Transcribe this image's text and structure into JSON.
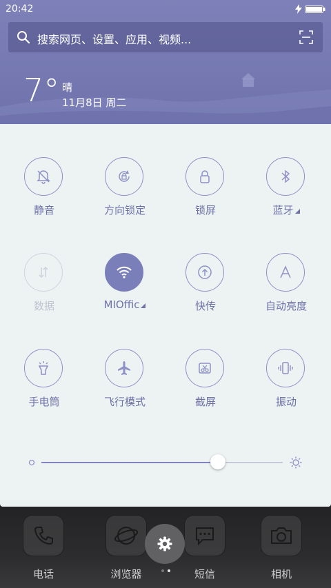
{
  "status": {
    "time": "20:42"
  },
  "search": {
    "placeholder": "搜索网页、设置、应用、视频..."
  },
  "weather": {
    "temp": "7°",
    "condition": "晴",
    "date": "11月8日 周二"
  },
  "colors": {
    "accent": "#7b7fb9",
    "panel": "#edf2f2",
    "header": "#7679b2"
  },
  "toggles": [
    {
      "label": "静音",
      "icon": "bell-off-icon",
      "state": "off"
    },
    {
      "label": "方向锁定",
      "icon": "rotation-lock-icon",
      "state": "off"
    },
    {
      "label": "锁屏",
      "icon": "lock-icon",
      "state": "off"
    },
    {
      "label": "蓝牙",
      "icon": "bluetooth-icon",
      "state": "off",
      "expandable": true
    },
    {
      "label": "数据",
      "icon": "mobile-data-icon",
      "state": "disabled"
    },
    {
      "label": "MIOffic",
      "icon": "wifi-icon",
      "state": "on",
      "expandable": true
    },
    {
      "label": "快传",
      "icon": "upload-icon",
      "state": "off"
    },
    {
      "label": "自动亮度",
      "icon": "auto-brightness-icon",
      "state": "off"
    },
    {
      "label": "手电筒",
      "icon": "flashlight-icon",
      "state": "off"
    },
    {
      "label": "飞行模式",
      "icon": "airplane-icon",
      "state": "off"
    },
    {
      "label": "截屏",
      "icon": "screenshot-icon",
      "state": "off"
    },
    {
      "label": "振动",
      "icon": "vibrate-icon",
      "state": "off"
    }
  ],
  "brightness": {
    "level": 0.73
  },
  "dock": {
    "apps": [
      {
        "label": "电话",
        "icon": "phone-icon"
      },
      {
        "label": "浏览器",
        "icon": "browser-icon"
      },
      {
        "label": "短信",
        "icon": "message-icon"
      },
      {
        "label": "相机",
        "icon": "camera-icon"
      }
    ],
    "page_count": 2,
    "current_page": 2
  }
}
